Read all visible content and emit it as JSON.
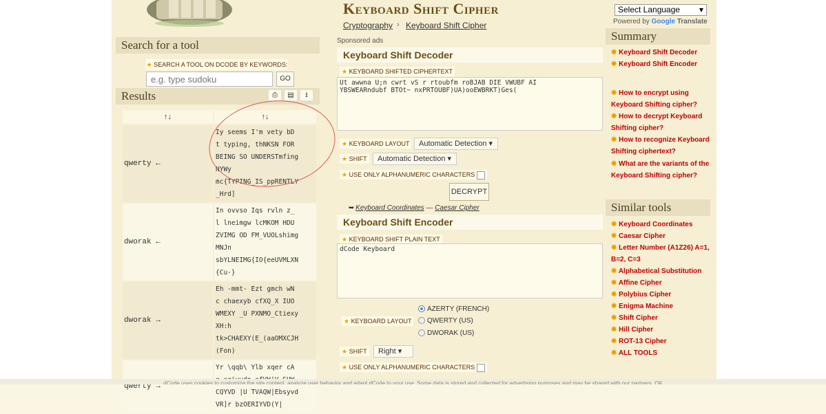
{
  "header": {
    "title": "Keyboard Shift Cipher",
    "breadcrumb": [
      "Cryptography",
      "Keyboard Shift Cipher"
    ]
  },
  "search": {
    "heading": "Search for a tool",
    "label": "SEARCH A TOOL ON DCODE BY KEYWORDS:",
    "placeholder": "e.g. type sudoku",
    "go_label": "GO"
  },
  "results": {
    "heading": "Results",
    "col1": "↑↓",
    "col2": "↑↓",
    "rows": [
      {
        "key": "qwerty ←",
        "value": "Iy seems I'm vety bD\nt typing, thNKSN FOR\nBEING SO UNDERSTmfing\nNYWy\nmc{TYPING_IS_ppRENTLY\n_Hrd]"
      },
      {
        "key": "dworak ←",
        "value": "In ovvso Iqs rvln z_\nl lneimgw lcMKOM HDU\nZVIMG OD FM_VUOLshimg\nMNJn\nsbYLNEIMG{IO{eeUVMLXN\n{Cu-}"
      },
      {
        "key": "dworak →",
        "value": "Eh -mmt- Ezt gmch wN\nc chaexyb cfXQ_X IUO\nWMEXY _U PXNMO_Ctiexy\nXH:h\ntk>CHAEXY(E_(aaOMXCJH\n(Fon)"
      },
      {
        "key": "qwerty →",
        "value": "Yr \\qqb\\ Ylb xqer cA\ne eriyvdn efVH|V SUW\nCQYVD |U TVAQW|Ebsyvd\nVR]r bzOERIYVD(Y|"
      }
    ]
  },
  "sponsored": "Sponsored ads",
  "decoder": {
    "heading": "Keyboard Shift Decoder",
    "ciphertext_label": "KEYBOARD SHIFTED CIPHERTEXT",
    "ciphertext": "Ut awwna U;n cwrt vS r rtoubfm roBJAB DIE VWUBF AI\nYBSWEARndubf BTOt~ nxPRTOUBF)UA)ooEWBRKT)Ges(",
    "layout_label": "KEYBOARD LAYOUT",
    "layout_value": "Automatic Detection",
    "shift_label": "SHIFT",
    "shift_value": "Automatic Detection",
    "alnum_label": "USE ONLY ALPHANUMERIC CHARACTERS",
    "decrypt_label": "DECRYPT",
    "links_prefix": "➥",
    "link1": "Keyboard Coordinates",
    "link_sep": "—",
    "link2": "Caesar Cipher"
  },
  "encoder": {
    "heading": "Keyboard Shift Encoder",
    "plaintext_label": "KEYBOARD SHIFT PLAIN TEXT",
    "plaintext": "dCode Keyboard",
    "layout_label": "KEYBOARD LAYOUT",
    "layouts": [
      "AZERTY (FRENCH)",
      "QWERTY (US)",
      "DWORAK (US)"
    ],
    "shift_label": "SHIFT",
    "shift_value": "Right",
    "alnum_label": "USE ONLY ALPHANUMERIC CHARACTERS"
  },
  "translate": {
    "select": "Select Language",
    "powered": "Powered by",
    "google": "Google",
    "translate": "Translate"
  },
  "summary": {
    "heading": "Summary",
    "items": [
      "Keyboard Shift Decoder",
      "Keyboard Shift Encoder",
      "How to encrypt using Keyboard Shifting cipher?",
      "How to decrypt Keyboard Shifting cipher?",
      "How to recognize Keyboard Shifting ciphertext?",
      "What are the variants of the Keyboard Shifting cipher?"
    ]
  },
  "similar": {
    "heading": "Similar tools",
    "items": [
      "Keyboard Coordinates",
      "Caesar Cipher",
      "Letter Number (A1Z26) A=1, B=2, C=3",
      "Alphabetical Substitution",
      "Affine Cipher",
      "Polybius Cipher",
      "Enigma Machine",
      "Shift Cipher",
      "Hill Cipher",
      "ROT-13 Cipher",
      "ALL TOOLS"
    ]
  },
  "cookie": "dCode uses cookies to customize the site content, analyze user behavior and adapt dCode to your use. Some data is stored and collected for advertising purposes and may be shared with our partners. OK",
  "colors": {
    "accent": "#c00000",
    "title": "#6b4e16",
    "annotation": "#e05555"
  }
}
